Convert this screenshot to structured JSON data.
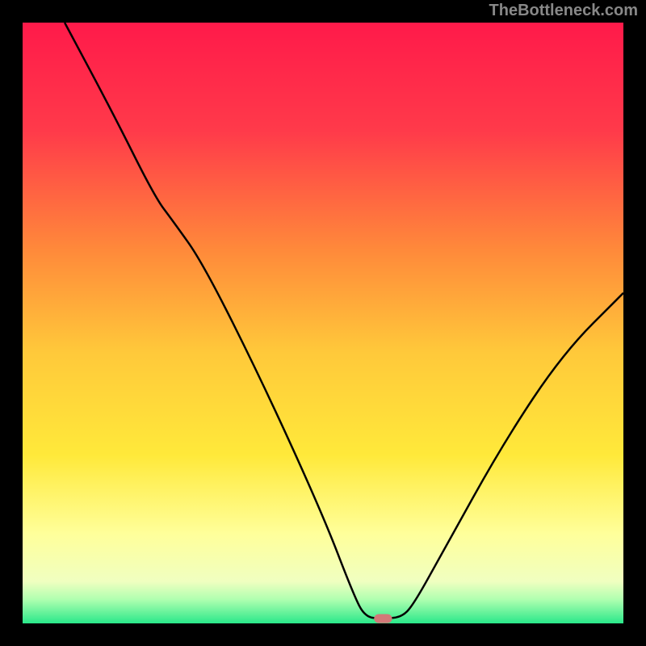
{
  "watermark": "TheBottleneck.com",
  "chart_data": {
    "type": "line",
    "title": "",
    "xlabel": "",
    "ylabel": "",
    "xlim": [
      0,
      100
    ],
    "ylim": [
      0,
      100
    ],
    "gradient_colors": {
      "top": "#FF1A4A",
      "upper_mid": "#FF7A3A",
      "mid": "#FFD93A",
      "lower_mid": "#FFFF9A",
      "bottom": "#2AE88A"
    },
    "frame_color": "#000000",
    "curve_color": "#000000",
    "marker": {
      "x": 60,
      "y": 0.8,
      "color": "#D27878",
      "width": 3,
      "height": 1.5
    },
    "curve_points": [
      {
        "x": 7,
        "y": 100
      },
      {
        "x": 15,
        "y": 85
      },
      {
        "x": 22,
        "y": 71
      },
      {
        "x": 25,
        "y": 67
      },
      {
        "x": 30,
        "y": 60
      },
      {
        "x": 40,
        "y": 40
      },
      {
        "x": 50,
        "y": 18
      },
      {
        "x": 55,
        "y": 5
      },
      {
        "x": 57,
        "y": 1
      },
      {
        "x": 60,
        "y": 0.8
      },
      {
        "x": 63,
        "y": 1
      },
      {
        "x": 65,
        "y": 3
      },
      {
        "x": 70,
        "y": 12
      },
      {
        "x": 80,
        "y": 30
      },
      {
        "x": 90,
        "y": 45
      },
      {
        "x": 100,
        "y": 55
      }
    ],
    "description": "V-shaped bottleneck curve on heat-gradient background, minimum at x≈60"
  }
}
